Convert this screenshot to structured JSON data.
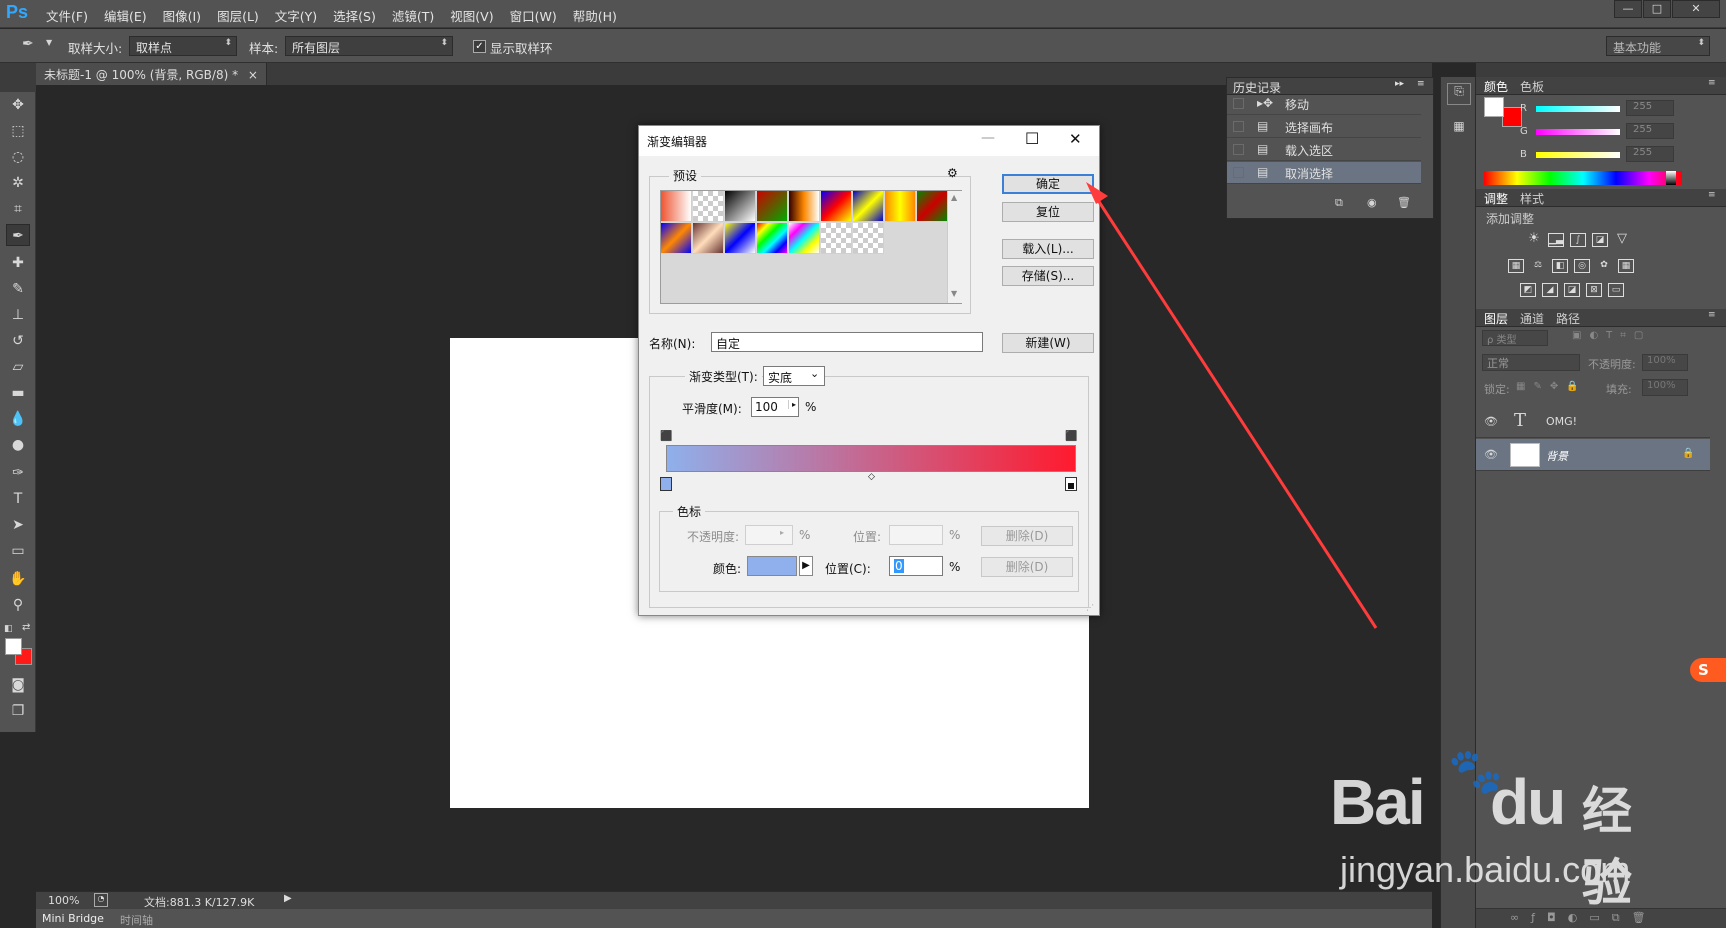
{
  "app": {
    "logo": "Ps",
    "menus": [
      "文件(F)",
      "编辑(E)",
      "图像(I)",
      "图层(L)",
      "文字(Y)",
      "选择(S)",
      "滤镜(T)",
      "视图(V)",
      "窗口(W)",
      "帮助(H)"
    ],
    "window_controls": {
      "minimize": "—",
      "restore": "□",
      "close": "✕"
    }
  },
  "options_bar": {
    "sample_size_label": "取样大小:",
    "sample_size_value": "取样点",
    "sample_label": "样本:",
    "sample_value": "所有图层",
    "show_ring_label": "显示取样环",
    "workspace": "基本功能"
  },
  "document": {
    "tab_title": "未标题-1 @ 100% (背景, RGB/8) *",
    "tab_close": "×"
  },
  "status": {
    "zoom": "100%",
    "doc_info": "文档:881.3 K/127.9K",
    "bottom_tabs": [
      "Mini Bridge",
      "时间轴"
    ]
  },
  "history": {
    "tab_label": "历史记录",
    "items": [
      {
        "label": "移动",
        "icon": "move-icon",
        "selected": false
      },
      {
        "label": "选择画布",
        "icon": "document-icon",
        "selected": false
      },
      {
        "label": "载入选区",
        "icon": "document-icon",
        "selected": false
      },
      {
        "label": "取消选择",
        "icon": "document-icon",
        "selected": true
      }
    ]
  },
  "color_panel": {
    "tabs": [
      "颜色",
      "色板"
    ],
    "channels": [
      {
        "name": "R",
        "value": "255",
        "color": "#00e5ff"
      },
      {
        "name": "G",
        "value": "255",
        "color": "#ff33ff"
      },
      {
        "name": "B",
        "value": "255",
        "color": "#ffff33"
      }
    ],
    "foreground": "#ffffff",
    "background": "#ff0000"
  },
  "adjustments_panel": {
    "tabs": [
      "调整",
      "样式"
    ],
    "title": "添加调整"
  },
  "layers_panel": {
    "tabs": [
      "图层",
      "通道",
      "路径"
    ],
    "filter_label": "ρ 类型",
    "blend_mode": "正常",
    "opacity_label": "不透明度:",
    "opacity_value": "100%",
    "lock_label": "锁定:",
    "fill_label": "填充:",
    "fill_value": "100%",
    "layers": [
      {
        "name": "OMG!",
        "type": "text",
        "selected": false
      },
      {
        "name": "背景",
        "type": "raster",
        "selected": true,
        "locked": true
      }
    ]
  },
  "gradient_editor": {
    "title": "渐变编辑器",
    "presets_label": "预设",
    "buttons": {
      "ok": "确定",
      "reset": "复位",
      "load": "载入(L)...",
      "save": "存储(S)...",
      "new": "新建(W)"
    },
    "name_label": "名称(N):",
    "name_value": "自定",
    "gradient_type_label": "渐变类型(T):",
    "gradient_type_value": "实底",
    "smoothness_label": "平滑度(M):",
    "smoothness_value": "100",
    "percent": "%",
    "stops_group_label": "色标",
    "opacity_label": "不透明度:",
    "location_label": "位置:",
    "delete_label": "删除(D)",
    "color_label": "颜色:",
    "color_location_label": "位置(C):",
    "color_location_value": "0",
    "stop_color": "#8fb0ec",
    "gradient_from": "#8fb0ec",
    "gradient_to": "#ff1a2e",
    "presets": [
      "linear-gradient(90deg,#e53,#fff)",
      "checker",
      "linear-gradient(90deg,#000,#fff)",
      "linear-gradient(135deg,#c00,#0a0)",
      "linear-gradient(90deg,#300,#f80,#fff)",
      "linear-gradient(135deg,#00f,#f00,#ff0)",
      "linear-gradient(135deg,#00c,#ff0,#00c)",
      "linear-gradient(90deg,#f80,#ff0,#f80)",
      "linear-gradient(135deg,#080,#c00,#080)",
      "linear-gradient(135deg,#00f,#f80,#00f)",
      "linear-gradient(135deg,#633,#fdb,#633)",
      "linear-gradient(135deg,#ff0,#00f,#fff)",
      "linear-gradient(135deg,#f00,#ff0,#0f0,#0ff,#00f,#f0f)",
      "linear-gradient(135deg,#fff,#f0f,#0ff,#ff0,#fff)",
      "checker",
      "checker"
    ]
  },
  "watermark": {
    "brand": "Bai",
    "brand2": "du",
    "product": "经验",
    "url": "jingyan.baidu.com"
  }
}
